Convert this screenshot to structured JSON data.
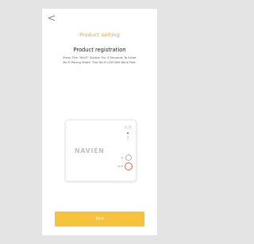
{
  "header": {
    "back_glyph": "<",
    "title": "Product setting"
  },
  "main": {
    "subtitle": "Product registration",
    "description_line1": "Press The \"Wi-Fi\" Button For 3 Seconds To Enter",
    "description_line2": "Wi-Fi Paring Mode. The Wi-Fi LED Will Blink Red."
  },
  "device": {
    "brand": "NAVIEN",
    "status_icons": [
      "wifi-signal-icon",
      "led-blinking-red-icon",
      "led-off-icon",
      "check-icon"
    ],
    "buttons": [
      {
        "label": "W",
        "state": "normal"
      },
      {
        "label": "Wi-Fi",
        "state": "highlighted"
      }
    ]
  },
  "footer": {
    "next_label": "Next"
  },
  "colors": {
    "background": "#e4e4e4",
    "accent_title": "#e3a62f",
    "button": "#f7c23e",
    "wifi_ring": "#e0603f",
    "led_red": "#d8442a"
  }
}
